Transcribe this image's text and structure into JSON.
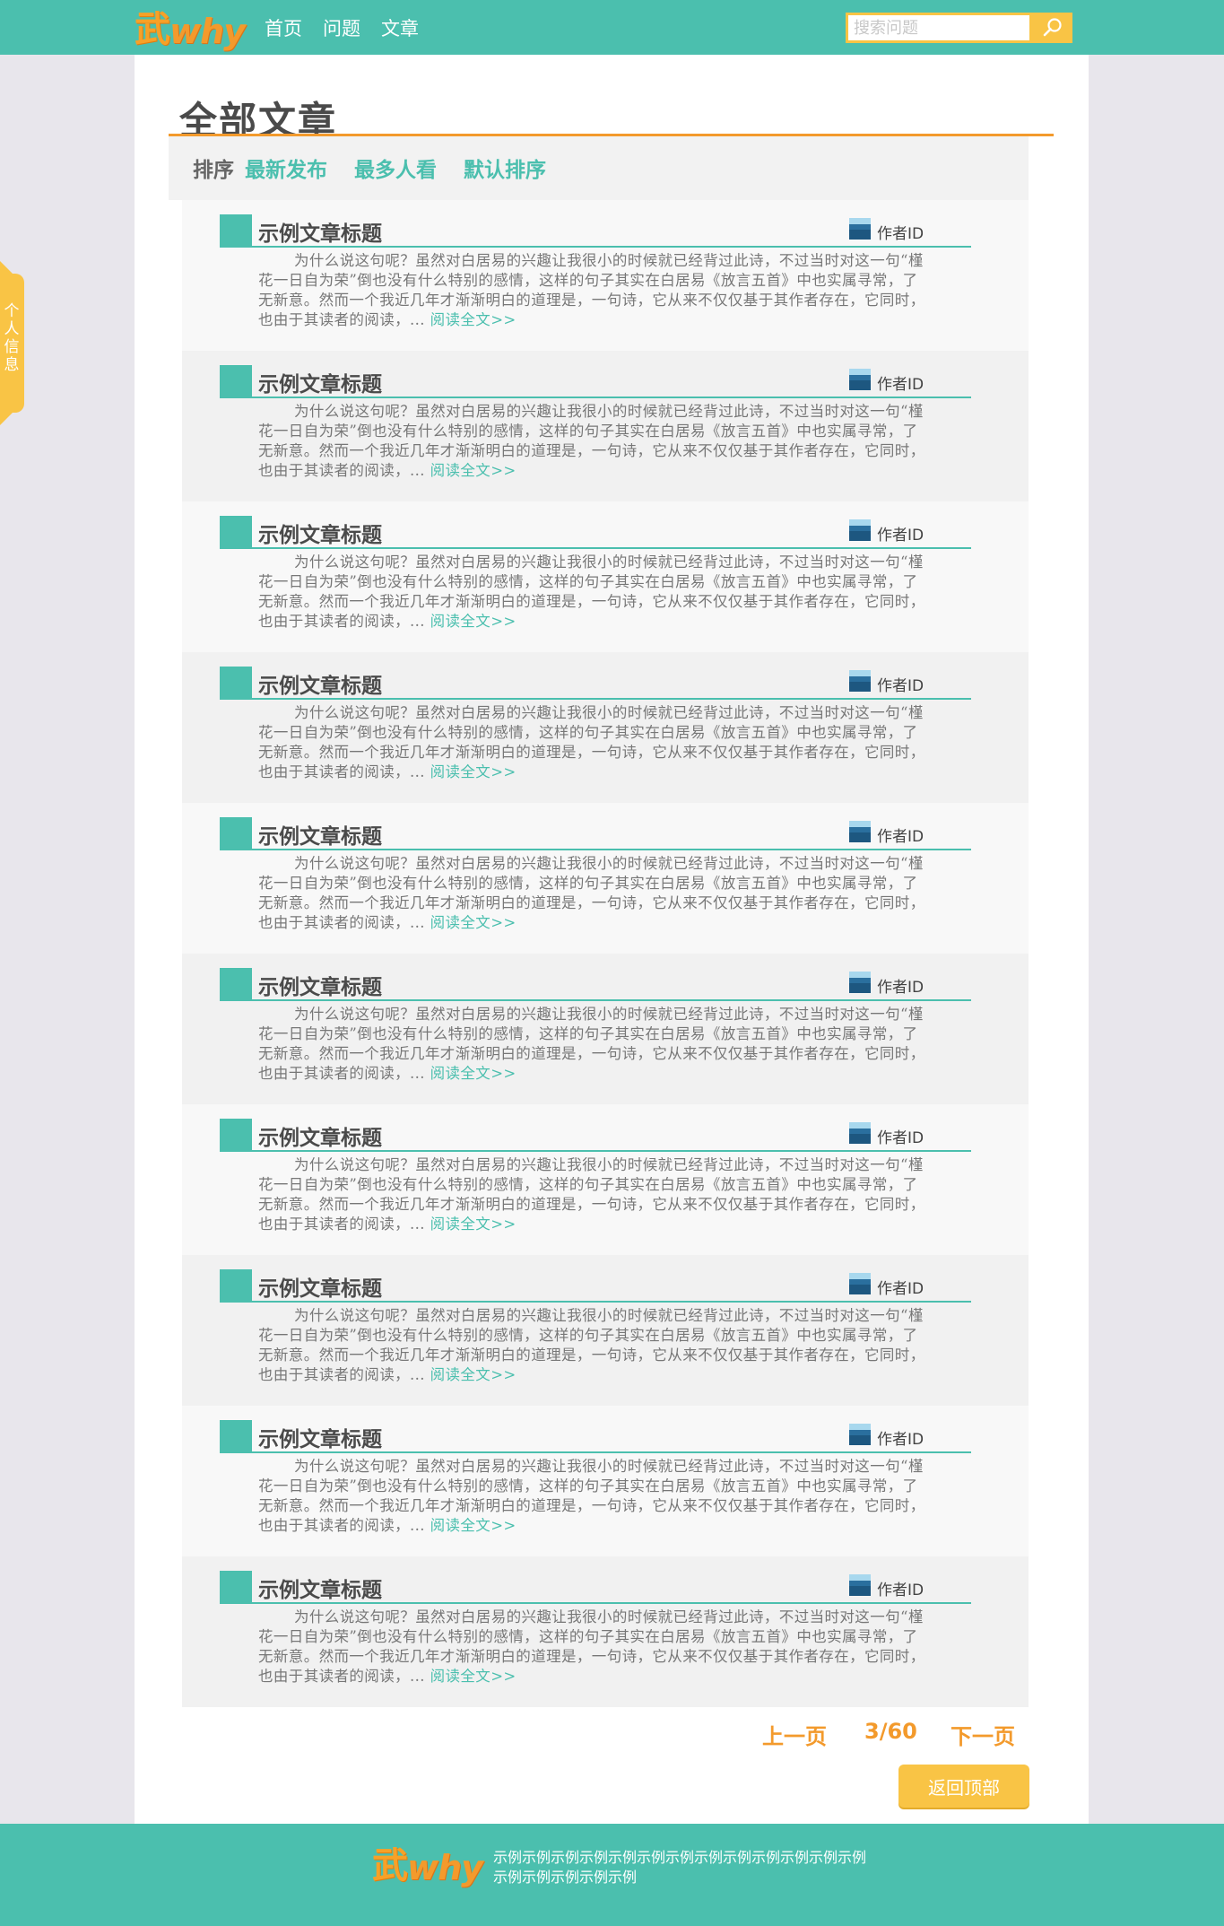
{
  "header": {
    "logo_wu": "武",
    "logo_why": "why",
    "nav": [
      "首页",
      "问题",
      "文章"
    ],
    "search_placeholder": "搜索问题"
  },
  "page_title": "全部文章",
  "sort": {
    "label": "排序",
    "options": [
      "最新发布",
      "最多人看",
      "默认排序"
    ]
  },
  "articles": [
    {
      "title": "示例文章标题",
      "author": "作者ID",
      "excerpt": "为什么说这句呢？虽然对白居易的兴趣让我很小的时候就已经背过此诗，不过当时对这一句“槿花一日自为荣”倒也没有什么特别的感情，这样的句子其实在白居易《放言五首》中也实属寻常，了无新意。然而一个我近几年才渐渐明白的道理是，一句诗，它从来不仅仅基于其作者存在，它同时，也由于其读者的阅读，...",
      "more": "阅读全文>>"
    },
    {
      "title": "示例文章标题",
      "author": "作者ID",
      "excerpt": "为什么说这句呢？虽然对白居易的兴趣让我很小的时候就已经背过此诗，不过当时对这一句“槿花一日自为荣”倒也没有什么特别的感情，这样的句子其实在白居易《放言五首》中也实属寻常，了无新意。然而一个我近几年才渐渐明白的道理是，一句诗，它从来不仅仅基于其作者存在，它同时，也由于其读者的阅读，...",
      "more": "阅读全文>>"
    },
    {
      "title": "示例文章标题",
      "author": "作者ID",
      "excerpt": "为什么说这句呢？虽然对白居易的兴趣让我很小的时候就已经背过此诗，不过当时对这一句“槿花一日自为荣”倒也没有什么特别的感情，这样的句子其实在白居易《放言五首》中也实属寻常，了无新意。然而一个我近几年才渐渐明白的道理是，一句诗，它从来不仅仅基于其作者存在，它同时，也由于其读者的阅读，...",
      "more": "阅读全文>>"
    },
    {
      "title": "示例文章标题",
      "author": "作者ID",
      "excerpt": "为什么说这句呢？虽然对白居易的兴趣让我很小的时候就已经背过此诗，不过当时对这一句“槿花一日自为荣”倒也没有什么特别的感情，这样的句子其实在白居易《放言五首》中也实属寻常，了无新意。然而一个我近几年才渐渐明白的道理是，一句诗，它从来不仅仅基于其作者存在，它同时，也由于其读者的阅读，...",
      "more": "阅读全文>>"
    },
    {
      "title": "示例文章标题",
      "author": "作者ID",
      "excerpt": "为什么说这句呢？虽然对白居易的兴趣让我很小的时候就已经背过此诗，不过当时对这一句“槿花一日自为荣”倒也没有什么特别的感情，这样的句子其实在白居易《放言五首》中也实属寻常，了无新意。然而一个我近几年才渐渐明白的道理是，一句诗，它从来不仅仅基于其作者存在，它同时，也由于其读者的阅读，...",
      "more": "阅读全文>>"
    },
    {
      "title": "示例文章标题",
      "author": "作者ID",
      "excerpt": "为什么说这句呢？虽然对白居易的兴趣让我很小的时候就已经背过此诗，不过当时对这一句“槿花一日自为荣”倒也没有什么特别的感情，这样的句子其实在白居易《放言五首》中也实属寻常，了无新意。然而一个我近几年才渐渐明白的道理是，一句诗，它从来不仅仅基于其作者存在，它同时，也由于其读者的阅读，...",
      "more": "阅读全文>>"
    },
    {
      "title": "示例文章标题",
      "author": "作者ID",
      "excerpt": "为什么说这句呢？虽然对白居易的兴趣让我很小的时候就已经背过此诗，不过当时对这一句“槿花一日自为荣”倒也没有什么特别的感情，这样的句子其实在白居易《放言五首》中也实属寻常，了无新意。然而一个我近几年才渐渐明白的道理是，一句诗，它从来不仅仅基于其作者存在，它同时，也由于其读者的阅读，...",
      "more": "阅读全文>>"
    },
    {
      "title": "示例文章标题",
      "author": "作者ID",
      "excerpt": "为什么说这句呢？虽然对白居易的兴趣让我很小的时候就已经背过此诗，不过当时对这一句“槿花一日自为荣”倒也没有什么特别的感情，这样的句子其实在白居易《放言五首》中也实属寻常，了无新意。然而一个我近几年才渐渐明白的道理是，一句诗，它从来不仅仅基于其作者存在，它同时，也由于其读者的阅读，...",
      "more": "阅读全文>>"
    },
    {
      "title": "示例文章标题",
      "author": "作者ID",
      "excerpt": "为什么说这句呢？虽然对白居易的兴趣让我很小的时候就已经背过此诗，不过当时对这一句“槿花一日自为荣”倒也没有什么特别的感情，这样的句子其实在白居易《放言五首》中也实属寻常，了无新意。然而一个我近几年才渐渐明白的道理是，一句诗，它从来不仅仅基于其作者存在，它同时，也由于其读者的阅读，...",
      "more": "阅读全文>>"
    },
    {
      "title": "示例文章标题",
      "author": "作者ID",
      "excerpt": "为什么说这句呢？虽然对白居易的兴趣让我很小的时候就已经背过此诗，不过当时对这一句“槿花一日自为荣”倒也没有什么特别的感情，这样的句子其实在白居易《放言五首》中也实属寻常，了无新意。然而一个我近几年才渐渐明白的道理是，一句诗，它从来不仅仅基于其作者存在，它同时，也由于其读者的阅读，...",
      "more": "阅读全文>>"
    }
  ],
  "pagination": {
    "prev": "上一页",
    "current": "3/60",
    "next": "下一页"
  },
  "back_to_top": "返回顶部",
  "side_tab": "个人信息",
  "footer": {
    "text": "示例示例示例示例示例示例示例示例示例示例示例示例示例示例示例示例示例示例"
  },
  "colors": {
    "primary": "#4bbfae",
    "accent": "#f39a2c",
    "yellow": "#f9c445"
  }
}
